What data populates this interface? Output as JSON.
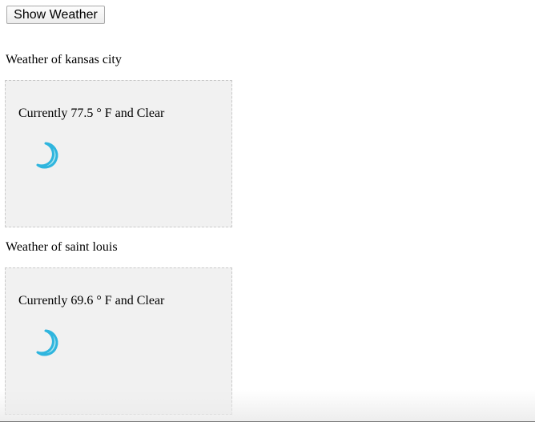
{
  "toolbar": {
    "show_weather_label": "Show Weather"
  },
  "cities": [
    {
      "heading": "Weather of kansas city",
      "current": "Currently 77.5 ° F and Clear",
      "icon": "moon-icon"
    },
    {
      "heading": "Weather of saint louis",
      "current": "Currently 69.6 ° F and Clear",
      "icon": "moon-icon"
    }
  ],
  "colors": {
    "panel_background": "#f1f1f1",
    "panel_border": "#c9c9c9",
    "moon_fill": "#a8e4ee",
    "moon_stroke": "#2fb5de"
  }
}
